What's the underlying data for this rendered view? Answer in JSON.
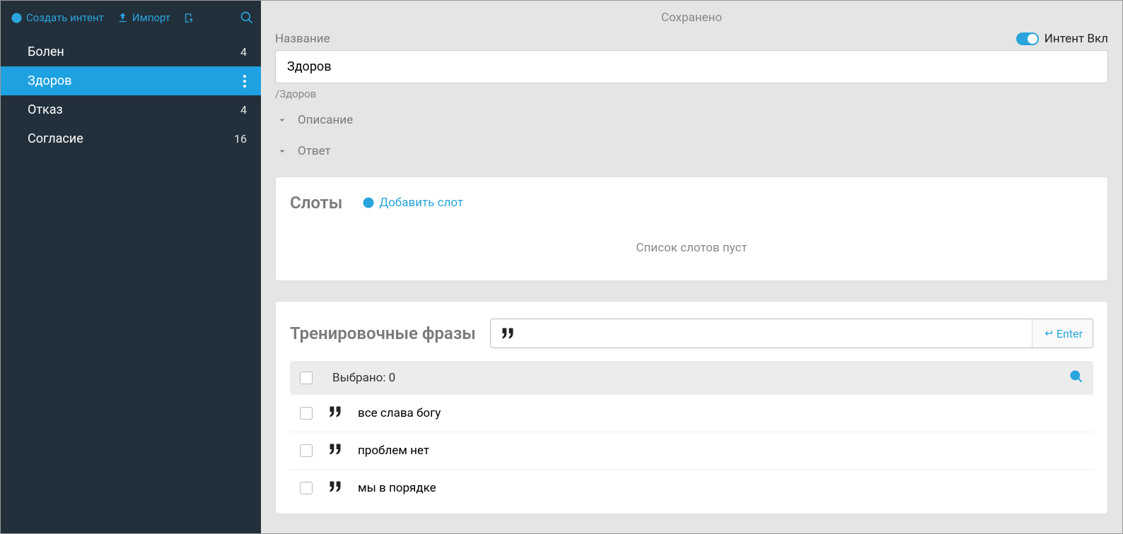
{
  "sidebar": {
    "create_intent": "Создать интент",
    "import": "Импорт",
    "items": [
      {
        "label": "Болен",
        "count": "4",
        "active": false
      },
      {
        "label": "Здоров",
        "count": "",
        "active": true
      },
      {
        "label": "Отказ",
        "count": "4",
        "active": false
      },
      {
        "label": "Согласие",
        "count": "16",
        "active": false
      }
    ]
  },
  "main": {
    "saved": "Сохранено",
    "name_label": "Название",
    "toggle_label": "Интент Вкл",
    "name_value": "Здоров",
    "path": "/Здоров",
    "collapse_desc": "Описание",
    "collapse_reply": "Ответ",
    "slots_title": "Слоты",
    "add_slot": "Добавить слот",
    "slots_empty": "Список слотов пуст",
    "phrases_title": "Тренировочные фразы",
    "enter_label": "Enter",
    "selected_label": "Выбрано: 0",
    "phrases": [
      "все слава богу",
      "проблем нет",
      "мы в порядке"
    ]
  }
}
